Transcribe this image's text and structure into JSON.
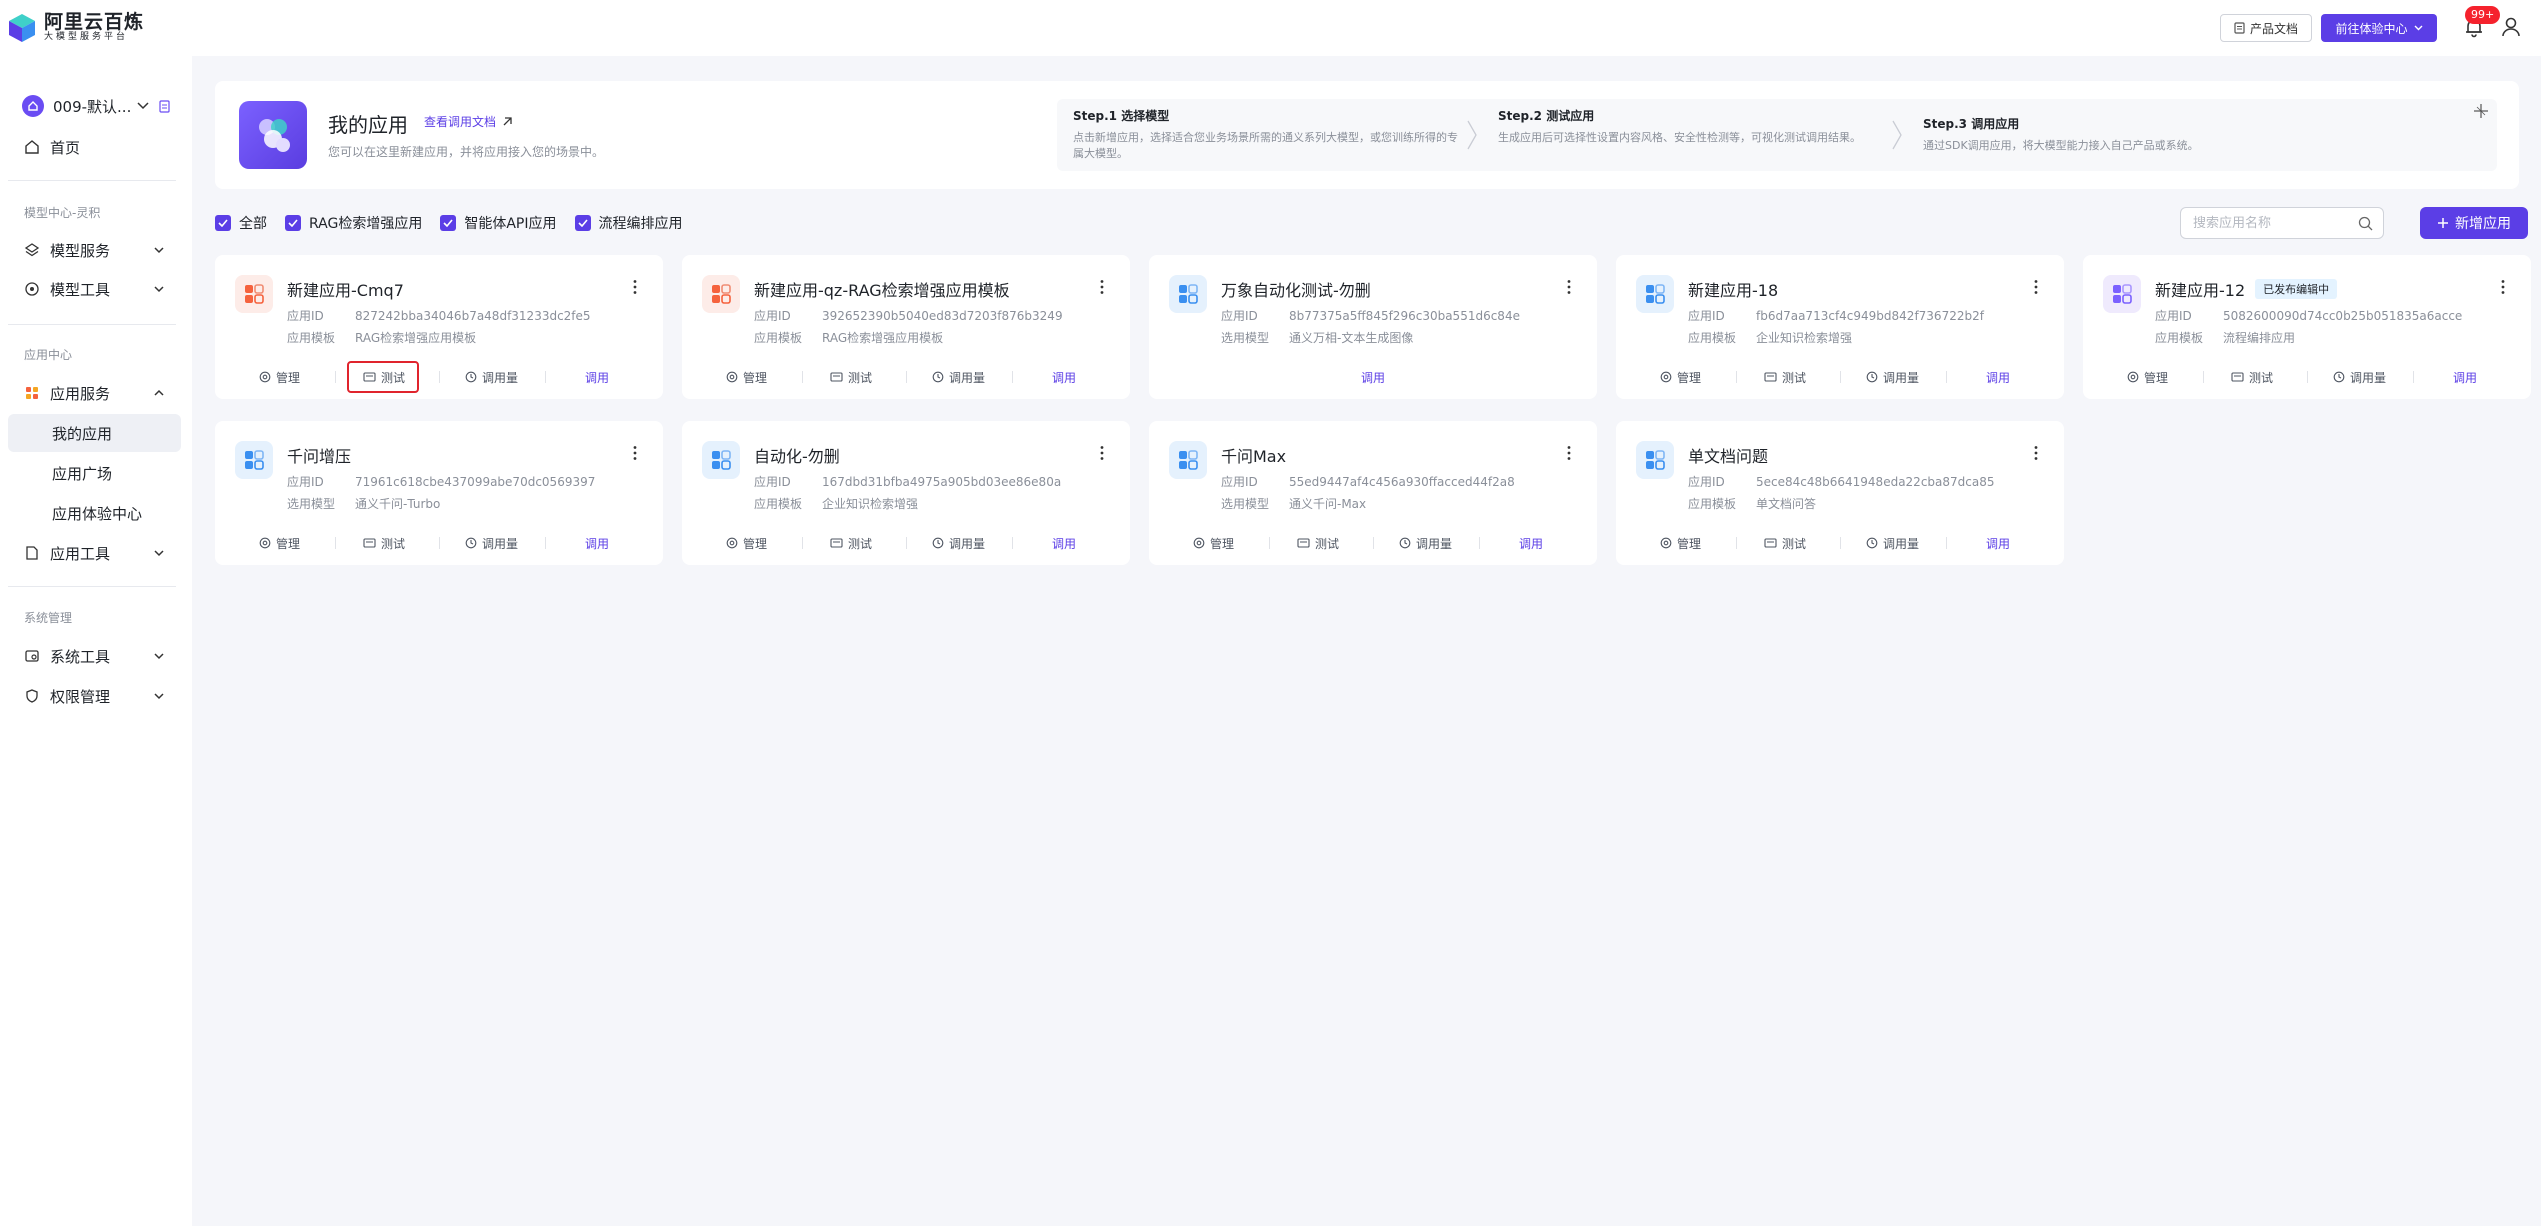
{
  "header": {
    "logo_title": "阿里云百炼",
    "logo_sub": "大模型服务平台",
    "docs_label": "产品文档",
    "experience_label": "前往体验中心",
    "notif_badge": "99+"
  },
  "sidebar": {
    "workspace": "009-默认...",
    "home": "首页",
    "section1": "模型中心-灵积",
    "model_service": "模型服务",
    "model_tools": "模型工具",
    "section2": "应用中心",
    "app_service": "应用服务",
    "my_apps": "我的应用",
    "app_square": "应用广场",
    "app_experience": "应用体验中心",
    "app_tools": "应用工具",
    "section3": "系统管理",
    "system_tools": "系统工具",
    "permission": "权限管理"
  },
  "hero": {
    "title": "我的应用",
    "link": "查看调用文档",
    "desc": "您可以在这里新建应用，并将应用接入您的场景中。",
    "steps": [
      {
        "title": "Step.1 选择模型",
        "desc": "点击新增应用，选择适合您业务场景所需的通义系列大模型，或您训练所得的专属大模型。"
      },
      {
        "title": "Step.2 测试应用",
        "desc": "生成应用后可选择性设置内容风格、安全性检测等，可视化测试调用结果。"
      },
      {
        "title": "Step.3 调用应用",
        "desc": "通过SDK调用应用，将大模型能力接入自己产品或系统。"
      }
    ]
  },
  "filters": [
    "全部",
    "RAG检索增强应用",
    "智能体API应用",
    "流程编排应用"
  ],
  "search_placeholder": "搜索应用名称",
  "new_app_label": "新增应用",
  "actions": {
    "manage": "管理",
    "test": "测试",
    "usage": "调用量",
    "call": "调用"
  },
  "cards": [
    {
      "title": "新建应用-Cmq7",
      "id_label": "应用ID",
      "id": "827242bba34046b7a48df31233dc2fe5",
      "t_label": "应用模板",
      "t_value": "RAG检索增强应用模板",
      "icon": "red"
    },
    {
      "title": "新建应用-qz-RAG检索增强应用模板",
      "id_label": "应用ID",
      "id": "392652390b5040ed83d7203f876b3249",
      "t_label": "应用模板",
      "t_value": "RAG检索增强应用模板",
      "icon": "red"
    },
    {
      "title": "万象自动化测试-勿删",
      "id_label": "应用ID",
      "id": "8b77375a5ff845f296c30ba551d6c84e",
      "t_label": "选用模型",
      "t_value": "通义万相-文本生成图像",
      "icon": "blue"
    },
    {
      "title": "新建应用-18",
      "id_label": "应用ID",
      "id": "fb6d7aa713cf4c949bd842f736722b2f",
      "t_label": "应用模板",
      "t_value": "企业知识检索增强",
      "icon": "blue"
    },
    {
      "title": "新建应用-12",
      "tag": "已发布编辑中",
      "id_label": "应用ID",
      "id": "5082600090d74cc0b25b051835a6acce",
      "t_label": "应用模板",
      "t_value": "流程编排应用",
      "icon": "purple"
    },
    {
      "title": "千问增压",
      "id_label": "应用ID",
      "id": "71961c618cbe437099abe70dc0569397",
      "t_label": "选用模型",
      "t_value": "通义千问-Turbo",
      "icon": "blue"
    },
    {
      "title": "自动化-勿删",
      "id_label": "应用ID",
      "id": "167dbd31bfba4975a905bd03ee86e80a",
      "t_label": "应用模板",
      "t_value": "企业知识检索增强",
      "icon": "blue"
    },
    {
      "title": "千问Max",
      "id_label": "应用ID",
      "id": "55ed9447af4c456a930ffacced44f2a8",
      "t_label": "选用模型",
      "t_value": "通义千问-Max",
      "icon": "blue"
    },
    {
      "title": "单文档问题",
      "id_label": "应用ID",
      "id": "5ece84c48b6641948eda22cba87dca85",
      "t_label": "应用模板",
      "t_value": "单文档问答",
      "icon": "blue"
    }
  ]
}
